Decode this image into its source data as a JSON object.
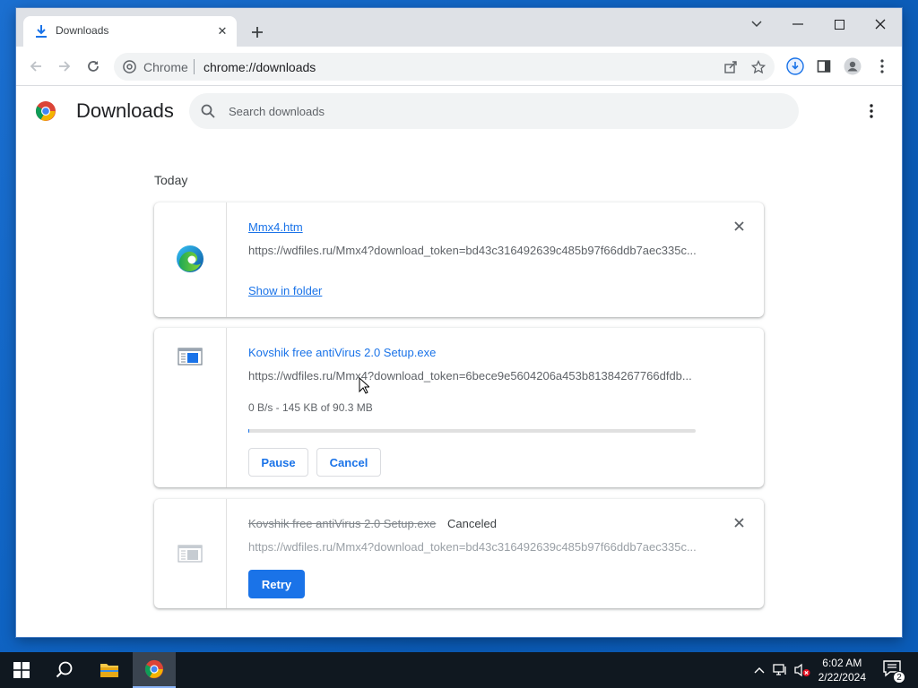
{
  "browser": {
    "tab": {
      "title": "Downloads",
      "icon": "download-icon"
    },
    "omnibox": {
      "site_name": "Chrome",
      "url": "chrome://downloads"
    }
  },
  "page": {
    "title": "Downloads",
    "search": {
      "placeholder": "Search downloads",
      "value": ""
    },
    "date_label": "Today"
  },
  "downloads": [
    {
      "file_name": "Mmx4.htm",
      "url": "https://wdfiles.ru/Mmx4?download_token=bd43c316492639c485b97f66ddb7aec335c...",
      "action": "Show in folder",
      "icon": "edge-icon"
    },
    {
      "file_name": "Kovshik free antiVirus 2.0 Setup.exe",
      "url": "https://wdfiles.ru/Mmx4?download_token=6bece9e5604206a453b81384267766dfdb...",
      "progress_text": "0 B/s - 145 KB of 90.3 MB",
      "progress_fraction": 0.0016,
      "pause_label": "Pause",
      "cancel_label": "Cancel",
      "icon": "installer-icon"
    },
    {
      "file_name": "Kovshik free antiVirus 2.0 Setup.exe",
      "status": "Canceled",
      "url": "https://wdfiles.ru/Mmx4?download_token=bd43c316492639c485b97f66ddb7aec335c...",
      "retry_label": "Retry",
      "icon": "installer-icon"
    }
  ],
  "taskbar": {
    "time": "6:02 AM",
    "date": "2/22/2024",
    "notification_count": "2"
  },
  "colors": {
    "accent": "#1a73e8",
    "taskbar": "#101820",
    "tabstrip": "#dee1e6"
  }
}
